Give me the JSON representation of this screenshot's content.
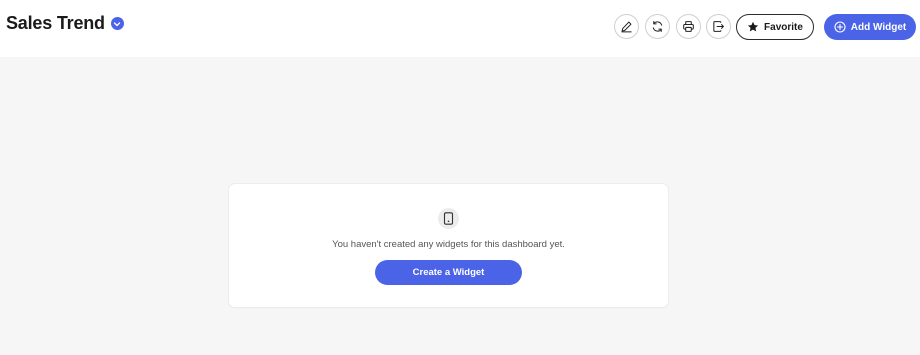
{
  "dashboard": {
    "title": "Sales Trend"
  },
  "toolbar": {
    "icons": [
      "pencil-icon",
      "refresh-icon",
      "print-icon",
      "export-icon"
    ],
    "favorite_label": "Favorite",
    "add_widget_label": "Add Widget"
  },
  "empty_state": {
    "message": "You haven't created any widgets for this dashboard yet.",
    "cta_label": "Create a Widget",
    "icon": "tablet-icon"
  },
  "colors": {
    "accent": "#4a63e7",
    "background": "#f6f6f6",
    "surface": "#ffffff"
  }
}
